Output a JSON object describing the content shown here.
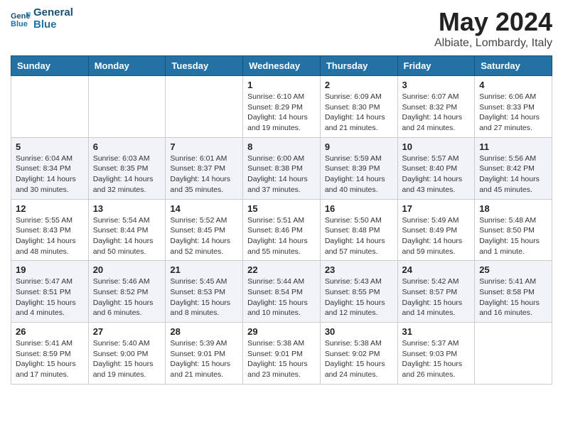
{
  "header": {
    "logo_line1": "General",
    "logo_line2": "Blue",
    "month_year": "May 2024",
    "location": "Albiate, Lombardy, Italy"
  },
  "weekdays": [
    "Sunday",
    "Monday",
    "Tuesday",
    "Wednesday",
    "Thursday",
    "Friday",
    "Saturday"
  ],
  "weeks": [
    [
      {
        "day": "",
        "info": ""
      },
      {
        "day": "",
        "info": ""
      },
      {
        "day": "",
        "info": ""
      },
      {
        "day": "1",
        "info": "Sunrise: 6:10 AM\nSunset: 8:29 PM\nDaylight: 14 hours\nand 19 minutes."
      },
      {
        "day": "2",
        "info": "Sunrise: 6:09 AM\nSunset: 8:30 PM\nDaylight: 14 hours\nand 21 minutes."
      },
      {
        "day": "3",
        "info": "Sunrise: 6:07 AM\nSunset: 8:32 PM\nDaylight: 14 hours\nand 24 minutes."
      },
      {
        "day": "4",
        "info": "Sunrise: 6:06 AM\nSunset: 8:33 PM\nDaylight: 14 hours\nand 27 minutes."
      }
    ],
    [
      {
        "day": "5",
        "info": "Sunrise: 6:04 AM\nSunset: 8:34 PM\nDaylight: 14 hours\nand 30 minutes."
      },
      {
        "day": "6",
        "info": "Sunrise: 6:03 AM\nSunset: 8:35 PM\nDaylight: 14 hours\nand 32 minutes."
      },
      {
        "day": "7",
        "info": "Sunrise: 6:01 AM\nSunset: 8:37 PM\nDaylight: 14 hours\nand 35 minutes."
      },
      {
        "day": "8",
        "info": "Sunrise: 6:00 AM\nSunset: 8:38 PM\nDaylight: 14 hours\nand 37 minutes."
      },
      {
        "day": "9",
        "info": "Sunrise: 5:59 AM\nSunset: 8:39 PM\nDaylight: 14 hours\nand 40 minutes."
      },
      {
        "day": "10",
        "info": "Sunrise: 5:57 AM\nSunset: 8:40 PM\nDaylight: 14 hours\nand 43 minutes."
      },
      {
        "day": "11",
        "info": "Sunrise: 5:56 AM\nSunset: 8:42 PM\nDaylight: 14 hours\nand 45 minutes."
      }
    ],
    [
      {
        "day": "12",
        "info": "Sunrise: 5:55 AM\nSunset: 8:43 PM\nDaylight: 14 hours\nand 48 minutes."
      },
      {
        "day": "13",
        "info": "Sunrise: 5:54 AM\nSunset: 8:44 PM\nDaylight: 14 hours\nand 50 minutes."
      },
      {
        "day": "14",
        "info": "Sunrise: 5:52 AM\nSunset: 8:45 PM\nDaylight: 14 hours\nand 52 minutes."
      },
      {
        "day": "15",
        "info": "Sunrise: 5:51 AM\nSunset: 8:46 PM\nDaylight: 14 hours\nand 55 minutes."
      },
      {
        "day": "16",
        "info": "Sunrise: 5:50 AM\nSunset: 8:48 PM\nDaylight: 14 hours\nand 57 minutes."
      },
      {
        "day": "17",
        "info": "Sunrise: 5:49 AM\nSunset: 8:49 PM\nDaylight: 14 hours\nand 59 minutes."
      },
      {
        "day": "18",
        "info": "Sunrise: 5:48 AM\nSunset: 8:50 PM\nDaylight: 15 hours\nand 1 minute."
      }
    ],
    [
      {
        "day": "19",
        "info": "Sunrise: 5:47 AM\nSunset: 8:51 PM\nDaylight: 15 hours\nand 4 minutes."
      },
      {
        "day": "20",
        "info": "Sunrise: 5:46 AM\nSunset: 8:52 PM\nDaylight: 15 hours\nand 6 minutes."
      },
      {
        "day": "21",
        "info": "Sunrise: 5:45 AM\nSunset: 8:53 PM\nDaylight: 15 hours\nand 8 minutes."
      },
      {
        "day": "22",
        "info": "Sunrise: 5:44 AM\nSunset: 8:54 PM\nDaylight: 15 hours\nand 10 minutes."
      },
      {
        "day": "23",
        "info": "Sunrise: 5:43 AM\nSunset: 8:55 PM\nDaylight: 15 hours\nand 12 minutes."
      },
      {
        "day": "24",
        "info": "Sunrise: 5:42 AM\nSunset: 8:57 PM\nDaylight: 15 hours\nand 14 minutes."
      },
      {
        "day": "25",
        "info": "Sunrise: 5:41 AM\nSunset: 8:58 PM\nDaylight: 15 hours\nand 16 minutes."
      }
    ],
    [
      {
        "day": "26",
        "info": "Sunrise: 5:41 AM\nSunset: 8:59 PM\nDaylight: 15 hours\nand 17 minutes."
      },
      {
        "day": "27",
        "info": "Sunrise: 5:40 AM\nSunset: 9:00 PM\nDaylight: 15 hours\nand 19 minutes."
      },
      {
        "day": "28",
        "info": "Sunrise: 5:39 AM\nSunset: 9:01 PM\nDaylight: 15 hours\nand 21 minutes."
      },
      {
        "day": "29",
        "info": "Sunrise: 5:38 AM\nSunset: 9:01 PM\nDaylight: 15 hours\nand 23 minutes."
      },
      {
        "day": "30",
        "info": "Sunrise: 5:38 AM\nSunset: 9:02 PM\nDaylight: 15 hours\nand 24 minutes."
      },
      {
        "day": "31",
        "info": "Sunrise: 5:37 AM\nSunset: 9:03 PM\nDaylight: 15 hours\nand 26 minutes."
      },
      {
        "day": "",
        "info": ""
      }
    ]
  ]
}
